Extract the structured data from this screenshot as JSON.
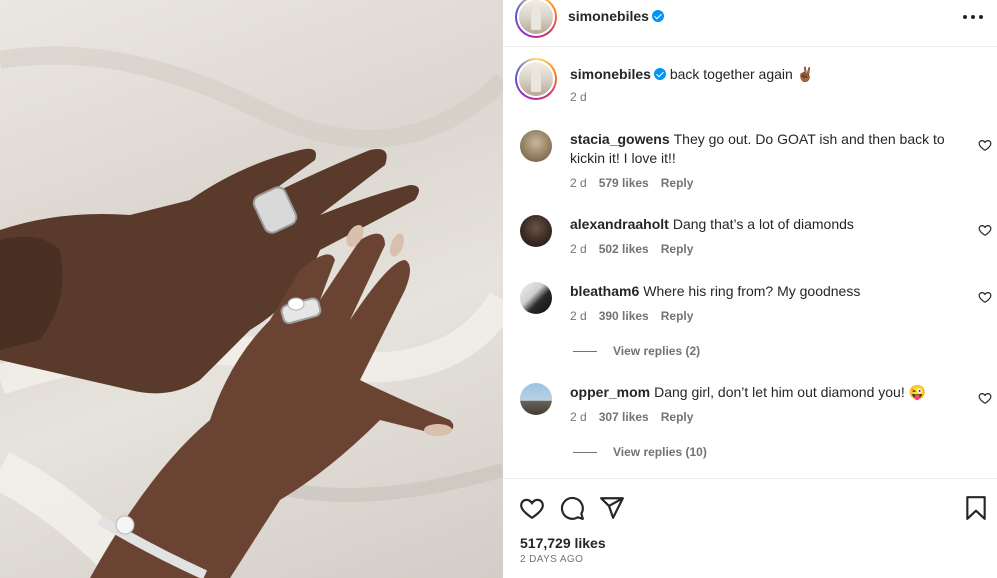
{
  "post": {
    "author": "simonebiles",
    "more_icon": "more-horizontal-icon"
  },
  "caption": {
    "username": "simonebiles",
    "text": "back together again",
    "emoji": "✌🏾",
    "time": "2 d"
  },
  "comments": [
    {
      "username": "stacia_gowens",
      "text": "They go out. Do GOAT ish and then back to kickin it! I love it!!",
      "time": "2 d",
      "likes": "579 likes",
      "reply": "Reply"
    },
    {
      "username": "alexandraaholt",
      "text": "Dang that’s a lot of diamonds",
      "time": "2 d",
      "likes": "502 likes",
      "reply": "Reply"
    },
    {
      "username": "bleatham6",
      "text": "Where his ring from? My goodness",
      "time": "2 d",
      "likes": "390 likes",
      "reply": "Reply",
      "view_replies": "View replies (2)"
    },
    {
      "username": "opper_mom",
      "text": "Dang girl, don’t let him out diamond you!",
      "emoji": "😜",
      "time": "2 d",
      "likes": "307 likes",
      "reply": "Reply",
      "view_replies": "View replies (10)"
    }
  ],
  "actions": {
    "likes": "517,729 likes",
    "date": "2 DAYS AGO",
    "icons": [
      "heart-icon",
      "comment-icon",
      "share-icon",
      "bookmark-icon"
    ]
  },
  "colors": {
    "verified": "#0095f6",
    "secondary_text": "#737373",
    "primary_text": "#262626"
  }
}
